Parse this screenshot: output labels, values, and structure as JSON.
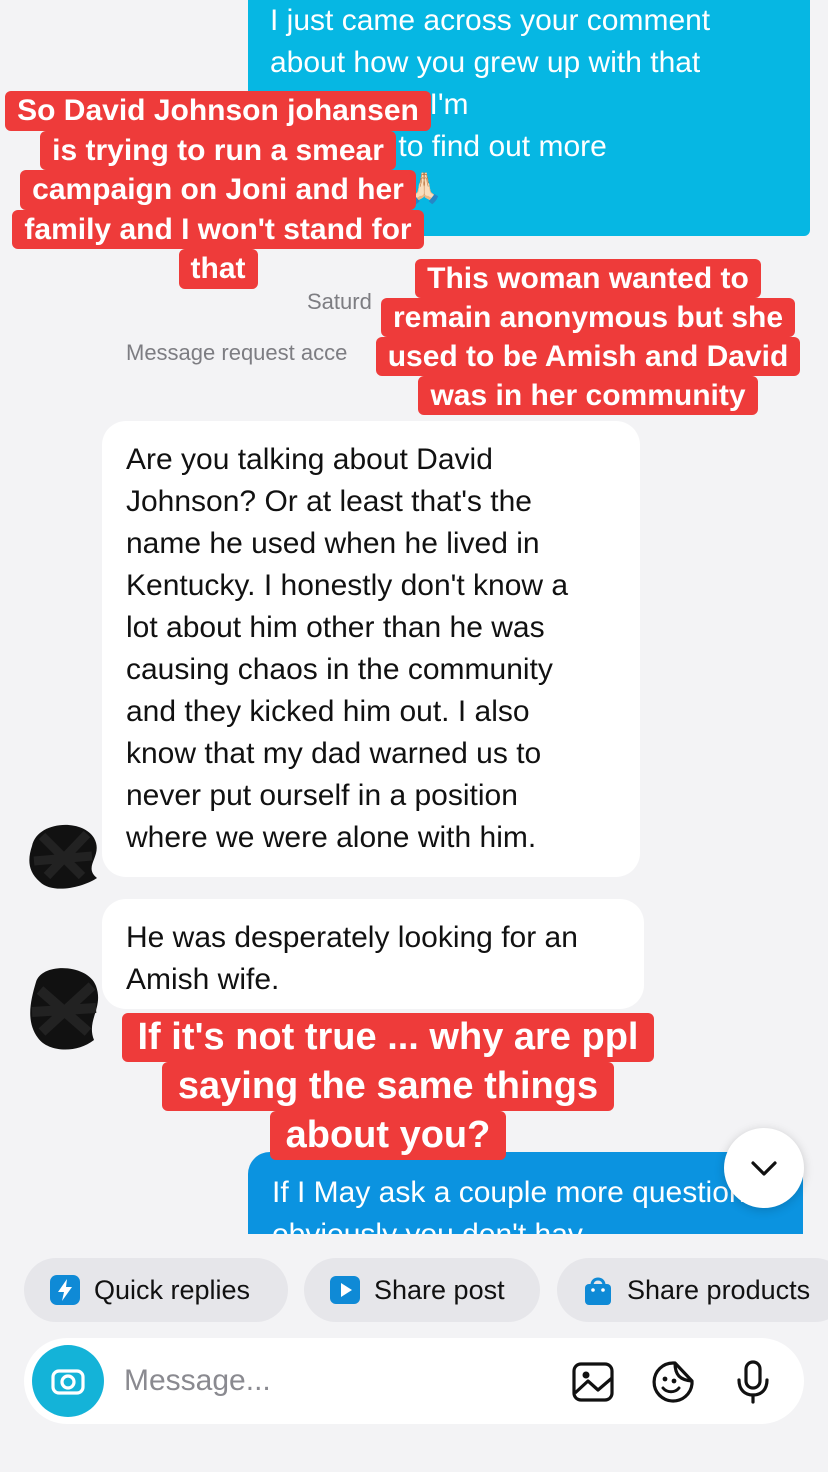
{
  "thread": {
    "sent_message_1": "I just came across your comment\nabout how you grew up with that\ncommunity. I'm\nely trying to find out more\non him 🙏🏻🙏🏻",
    "date_separator": "Saturd",
    "request_notice": "Message request acce",
    "received_message_1": "Are you talking about David\nJohnson? Or at least that's the\nname he used when he lived in\nKentucky. I honestly don't know a\nlot about him other than he was\ncausing chaos in the community\nand they kicked him out. I also\nknow that my dad warned us to\nnever put ourself in a position\nwhere we were alone with him.",
    "received_message_2": "He was desperately looking for an\nAmish wife.",
    "sent_message_2": "If I May ask a couple more\nquestions obviously you don't hav"
  },
  "captions": {
    "caption_1": [
      "So David Johnson johansen",
      "is trying to run a smear",
      "campaign on Joni and her",
      "family and I won't stand for",
      "that"
    ],
    "caption_2": [
      "This woman wanted to",
      "remain anonymous but she",
      "used to be Amish and David",
      "was in her community"
    ],
    "caption_3": [
      "If it's not true ... why are ppl",
      "saying the same things",
      "about you?"
    ]
  },
  "quick_actions": {
    "quick_replies": "Quick replies",
    "share_post": "Share post",
    "share_products": "Share products"
  },
  "composer": {
    "placeholder": "Message..."
  },
  "icons": {
    "scroll_down": "chevron-down-icon",
    "camera": "camera-icon",
    "gallery": "image-icon",
    "sticker": "sticker-icon",
    "voice": "microphone-icon"
  },
  "colors": {
    "sent_bubble": "#06b7e3",
    "sent_bubble_2": "#0b93e0",
    "caption_red": "#ee3b3a",
    "camera_button": "#14b3d8"
  }
}
